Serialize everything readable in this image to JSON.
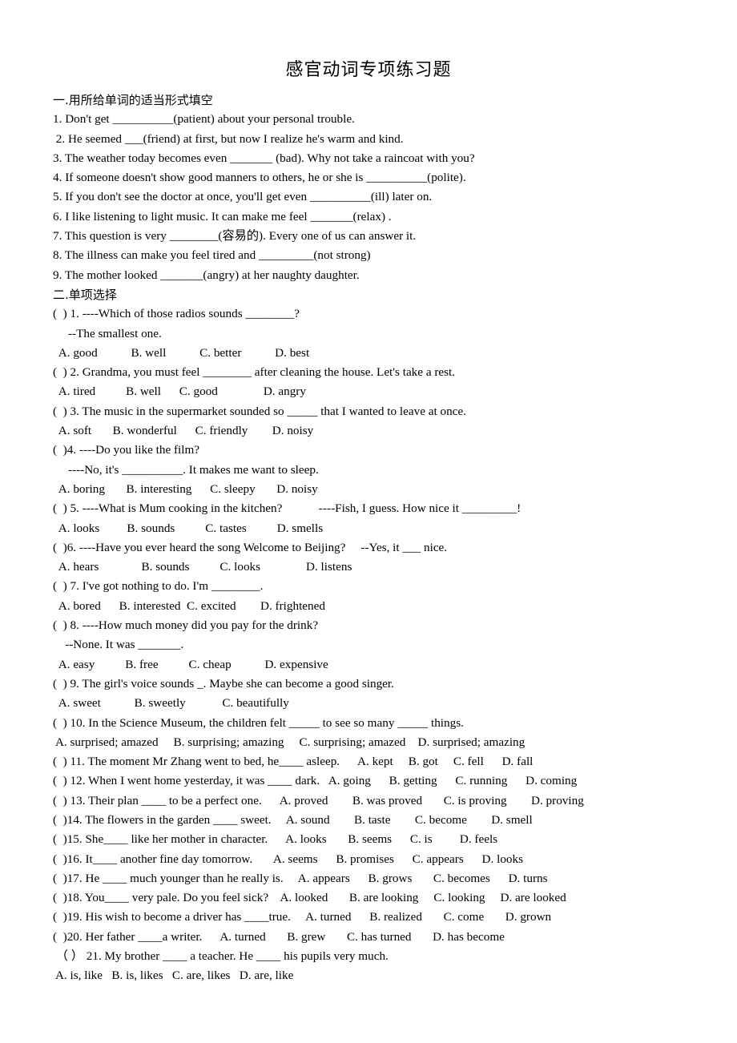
{
  "document": {
    "title": "感官动词专项练习题"
  },
  "sections": [
    {
      "heading": "一.用所给单词的适当形式填空",
      "lines": [
        "1. Don't get __________(patient) about your personal trouble.",
        " 2. He seemed ___(friend) at first, but now I realize he's warm and kind.",
        "3. The weather today becomes even _______ (bad). Why not take a raincoat with you?",
        "4. If someone doesn't show good manners to others, he or she is __________(polite).",
        "5. If you don't see the doctor at once, you'll get even __________(ill) later on.",
        "6. I like listening to light music. It can make me feel _______(relax) .",
        "7. This question is very ________(容易的). Every one of us can answer it.",
        "8. The illness can make you feel tired and _________(not strong)",
        "9. The mother looked _______(angry) at her naughty daughter."
      ]
    },
    {
      "heading": "二.单项选择",
      "lines": [
        "(  ) 1. ----Which of those radios sounds ________?",
        "     --The smallest one.",
        "  A. good           B. well           C. better           D. best",
        "(  ) 2. Grandma, you must feel ________ after cleaning the house. Let's take a rest.",
        "  A. tired          B. well      C. good               D. angry",
        "(  ) 3. The music in the supermarket sounded so _____ that I wanted to leave at once.",
        "  A. soft       B. wonderful      C. friendly        D. noisy",
        "(  )4. ----Do you like the film?",
        "     ----No, it's __________. It makes me want to sleep.",
        "  A. boring       B. interesting      C. sleepy       D. noisy",
        "(  ) 5. ----What is Mum cooking in the kitchen?            ----Fish, I guess. How nice it _________!",
        "  A. looks         B. sounds          C. tastes          D. smells",
        "(  )6. ----Have you ever heard the song Welcome to Beijing?     --Yes, it ___ nice.",
        "  A. hears              B. sounds          C. looks               D. listens",
        "(  ) 7. I've got nothing to do. I'm ________.",
        "  A. bored      B. interested  C. excited        D. frightened",
        "(  ) 8. ----How much money did you pay for the drink?",
        "    --None. It was _______.",
        "  A. easy          B. free          C. cheap           D. expensive",
        "(  ) 9. The girl's voice sounds _. Maybe she can become a good singer.",
        "  A. sweet           B. sweetly            C. beautifully",
        "(  ) 10. In the Science Museum, the children felt _____ to see so many _____ things.",
        " A. surprised; amazed     B. surprising; amazing     C. surprising; amazed    D. surprised; amazing",
        "(  ) 11. The moment Mr Zhang went to bed, he____ asleep.      A. kept     B. got     C. fell      D. fall",
        "(  ) 12. When I went home yesterday, it was ____ dark.   A. going      B. getting      C. running      D. coming",
        "(  ) 13. Their plan ____ to be a perfect one.      A. proved        B. was proved       C. is proving        D. proving",
        "(  )14. The flowers in the garden ____ sweet.     A. sound        B. taste        C. become        D. smell",
        "(  )15. She____ like her mother in character.      A. looks       B. seems      C. is         D. feels",
        "(  )16. It____ another fine day tomorrow.       A. seems      B. promises      C. appears      D. looks",
        "(  )17. He ____ much younger than he really is.     A. appears      B. grows       C. becomes      D. turns",
        "(  )18. You____ very pale. Do you feel sick?    A. looked       B. are looking     C. looking     D. are looked",
        "(  )19. His wish to become a driver has ____true.     A. turned      B. realized       C. come       D. grown",
        "(  )20. Her father ____a writer.      A. turned       B. grew       C. has turned       D. has become",
        " （ ） 21. My brother ____ a teacher. He ____ his pupils very much.",
        " A. is, like   B. is, likes   C. are, likes   D. are, like"
      ]
    }
  ]
}
